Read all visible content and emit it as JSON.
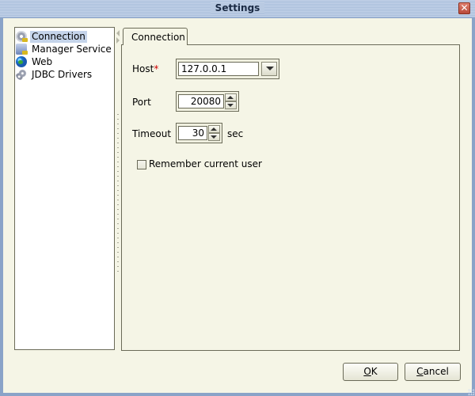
{
  "window": {
    "title": "Settings",
    "close_icon": "close-icon"
  },
  "sidebar": {
    "items": [
      {
        "label": "Connection",
        "icon": "connection-gear-icon",
        "selected": true
      },
      {
        "label": "Manager Service",
        "icon": "server-icon",
        "selected": false
      },
      {
        "label": "Web",
        "icon": "globe-icon",
        "selected": false
      },
      {
        "label": "JDBC Drivers",
        "icon": "gears-icon",
        "selected": false
      }
    ]
  },
  "main": {
    "tabs": [
      {
        "label": "Connection",
        "active": true
      }
    ],
    "host": {
      "label": "Host",
      "required_marker": "*",
      "value": "127.0.0.1"
    },
    "port": {
      "label": "Port",
      "value": "20080"
    },
    "timeout": {
      "label": "Timeout",
      "value": "30",
      "unit": "sec"
    },
    "remember_user": {
      "label": "Remember current user",
      "checked": false
    }
  },
  "footer": {
    "ok": {
      "mnemonic": "O",
      "rest": "K"
    },
    "cancel": {
      "mnemonic": "C",
      "rest": "ancel"
    }
  }
}
